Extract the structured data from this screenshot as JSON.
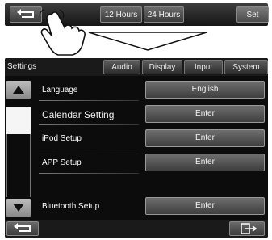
{
  "top_bar": {
    "back_icon": "return-arrow-icon",
    "buttons": [
      "12 Hours",
      "24 Hours",
      "Set"
    ]
  },
  "tabs": [
    "Settings",
    "Audio",
    "Display",
    "Input",
    "System"
  ],
  "rows": [
    {
      "label": "Language",
      "value": "English"
    },
    {
      "label": "Calendar Setting",
      "value": "Enter"
    },
    {
      "label": "iPod Setup",
      "value": "Enter"
    },
    {
      "label": "APP Setup",
      "value": "Enter"
    },
    {
      "label": "Bluetooth Setup",
      "value": "Enter"
    }
  ],
  "bottom_bar": {
    "back_icon": "return-arrow-icon",
    "exit_icon": "exit-icon"
  },
  "colors": {
    "panel_bg": "#0c0c0c",
    "button_gradient_top": "#6e6e6e",
    "button_gradient_bottom": "#3e3e3e",
    "text": "#ffffff"
  }
}
